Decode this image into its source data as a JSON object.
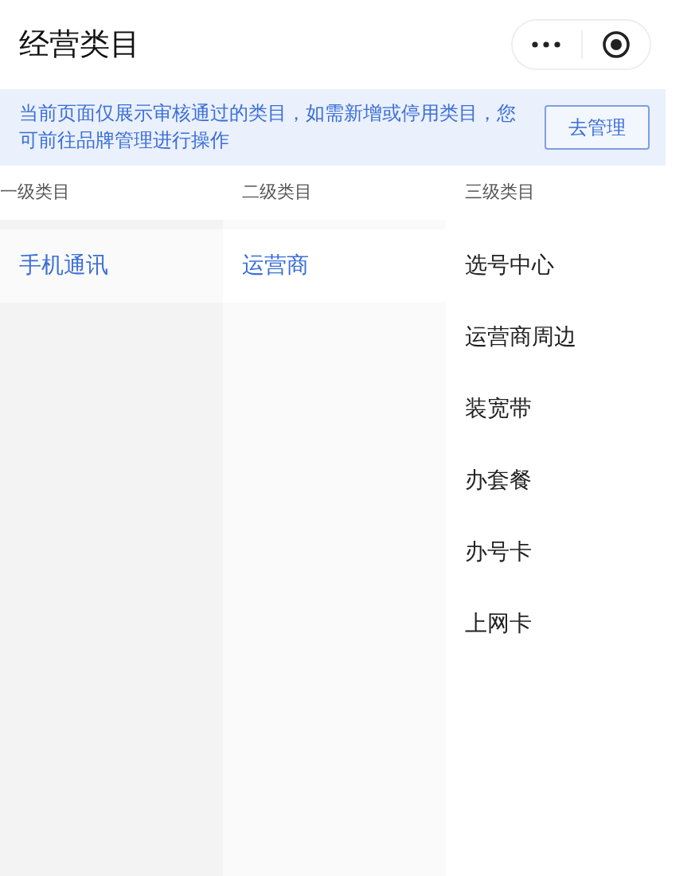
{
  "header": {
    "title": "经营类目"
  },
  "notice": {
    "text": "当前页面仅展示审核通过的类目，如需新增或停用类目，您可前往品牌管理进行操作",
    "button": "去管理"
  },
  "columns": [
    {
      "label": "一级类目",
      "items": [
        {
          "label": "手机通讯",
          "selected": true
        }
      ]
    },
    {
      "label": "二级类目",
      "items": [
        {
          "label": "运营商",
          "selected": true
        }
      ]
    },
    {
      "label": "三级类目",
      "items": [
        {
          "label": "选号中心",
          "selected": false
        },
        {
          "label": "运营商周边",
          "selected": false
        },
        {
          "label": "装宽带",
          "selected": false
        },
        {
          "label": "办套餐",
          "selected": false
        },
        {
          "label": "办号卡",
          "selected": false
        },
        {
          "label": "上网卡",
          "selected": false
        }
      ]
    }
  ]
}
